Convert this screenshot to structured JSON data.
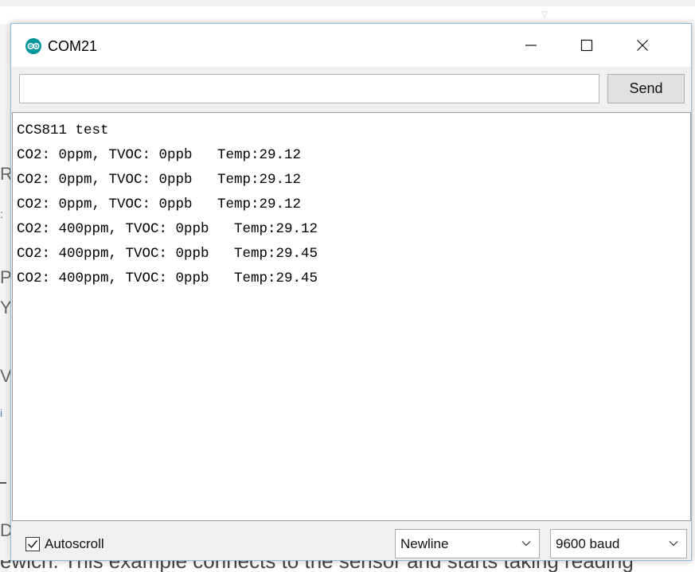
{
  "window": {
    "title": "COM21",
    "app_icon": "arduino-infinity-icon"
  },
  "send_bar": {
    "input_value": "",
    "input_placeholder": "",
    "send_label": "Send"
  },
  "output": {
    "lines": [
      "CCS811 test",
      "CO2: 0ppm, TVOC: 0ppb   Temp:29.12",
      "CO2: 0ppm, TVOC: 0ppb   Temp:29.12",
      "CO2: 0ppm, TVOC: 0ppb   Temp:29.12",
      "CO2: 400ppm, TVOC: 0ppb   Temp:29.12",
      "CO2: 400ppm, TVOC: 0ppb   Temp:29.45",
      "CO2: 400ppm, TVOC: 0ppb   Temp:29.45"
    ]
  },
  "footer": {
    "autoscroll_label": "Autoscroll",
    "autoscroll_checked": true,
    "line_ending": "Newline",
    "baud_rate": "9600 baud"
  },
  "colors": {
    "arduino_teal": "#00979c",
    "window_bg": "#f0f0f0",
    "border_accent": "#8cbcd8"
  }
}
